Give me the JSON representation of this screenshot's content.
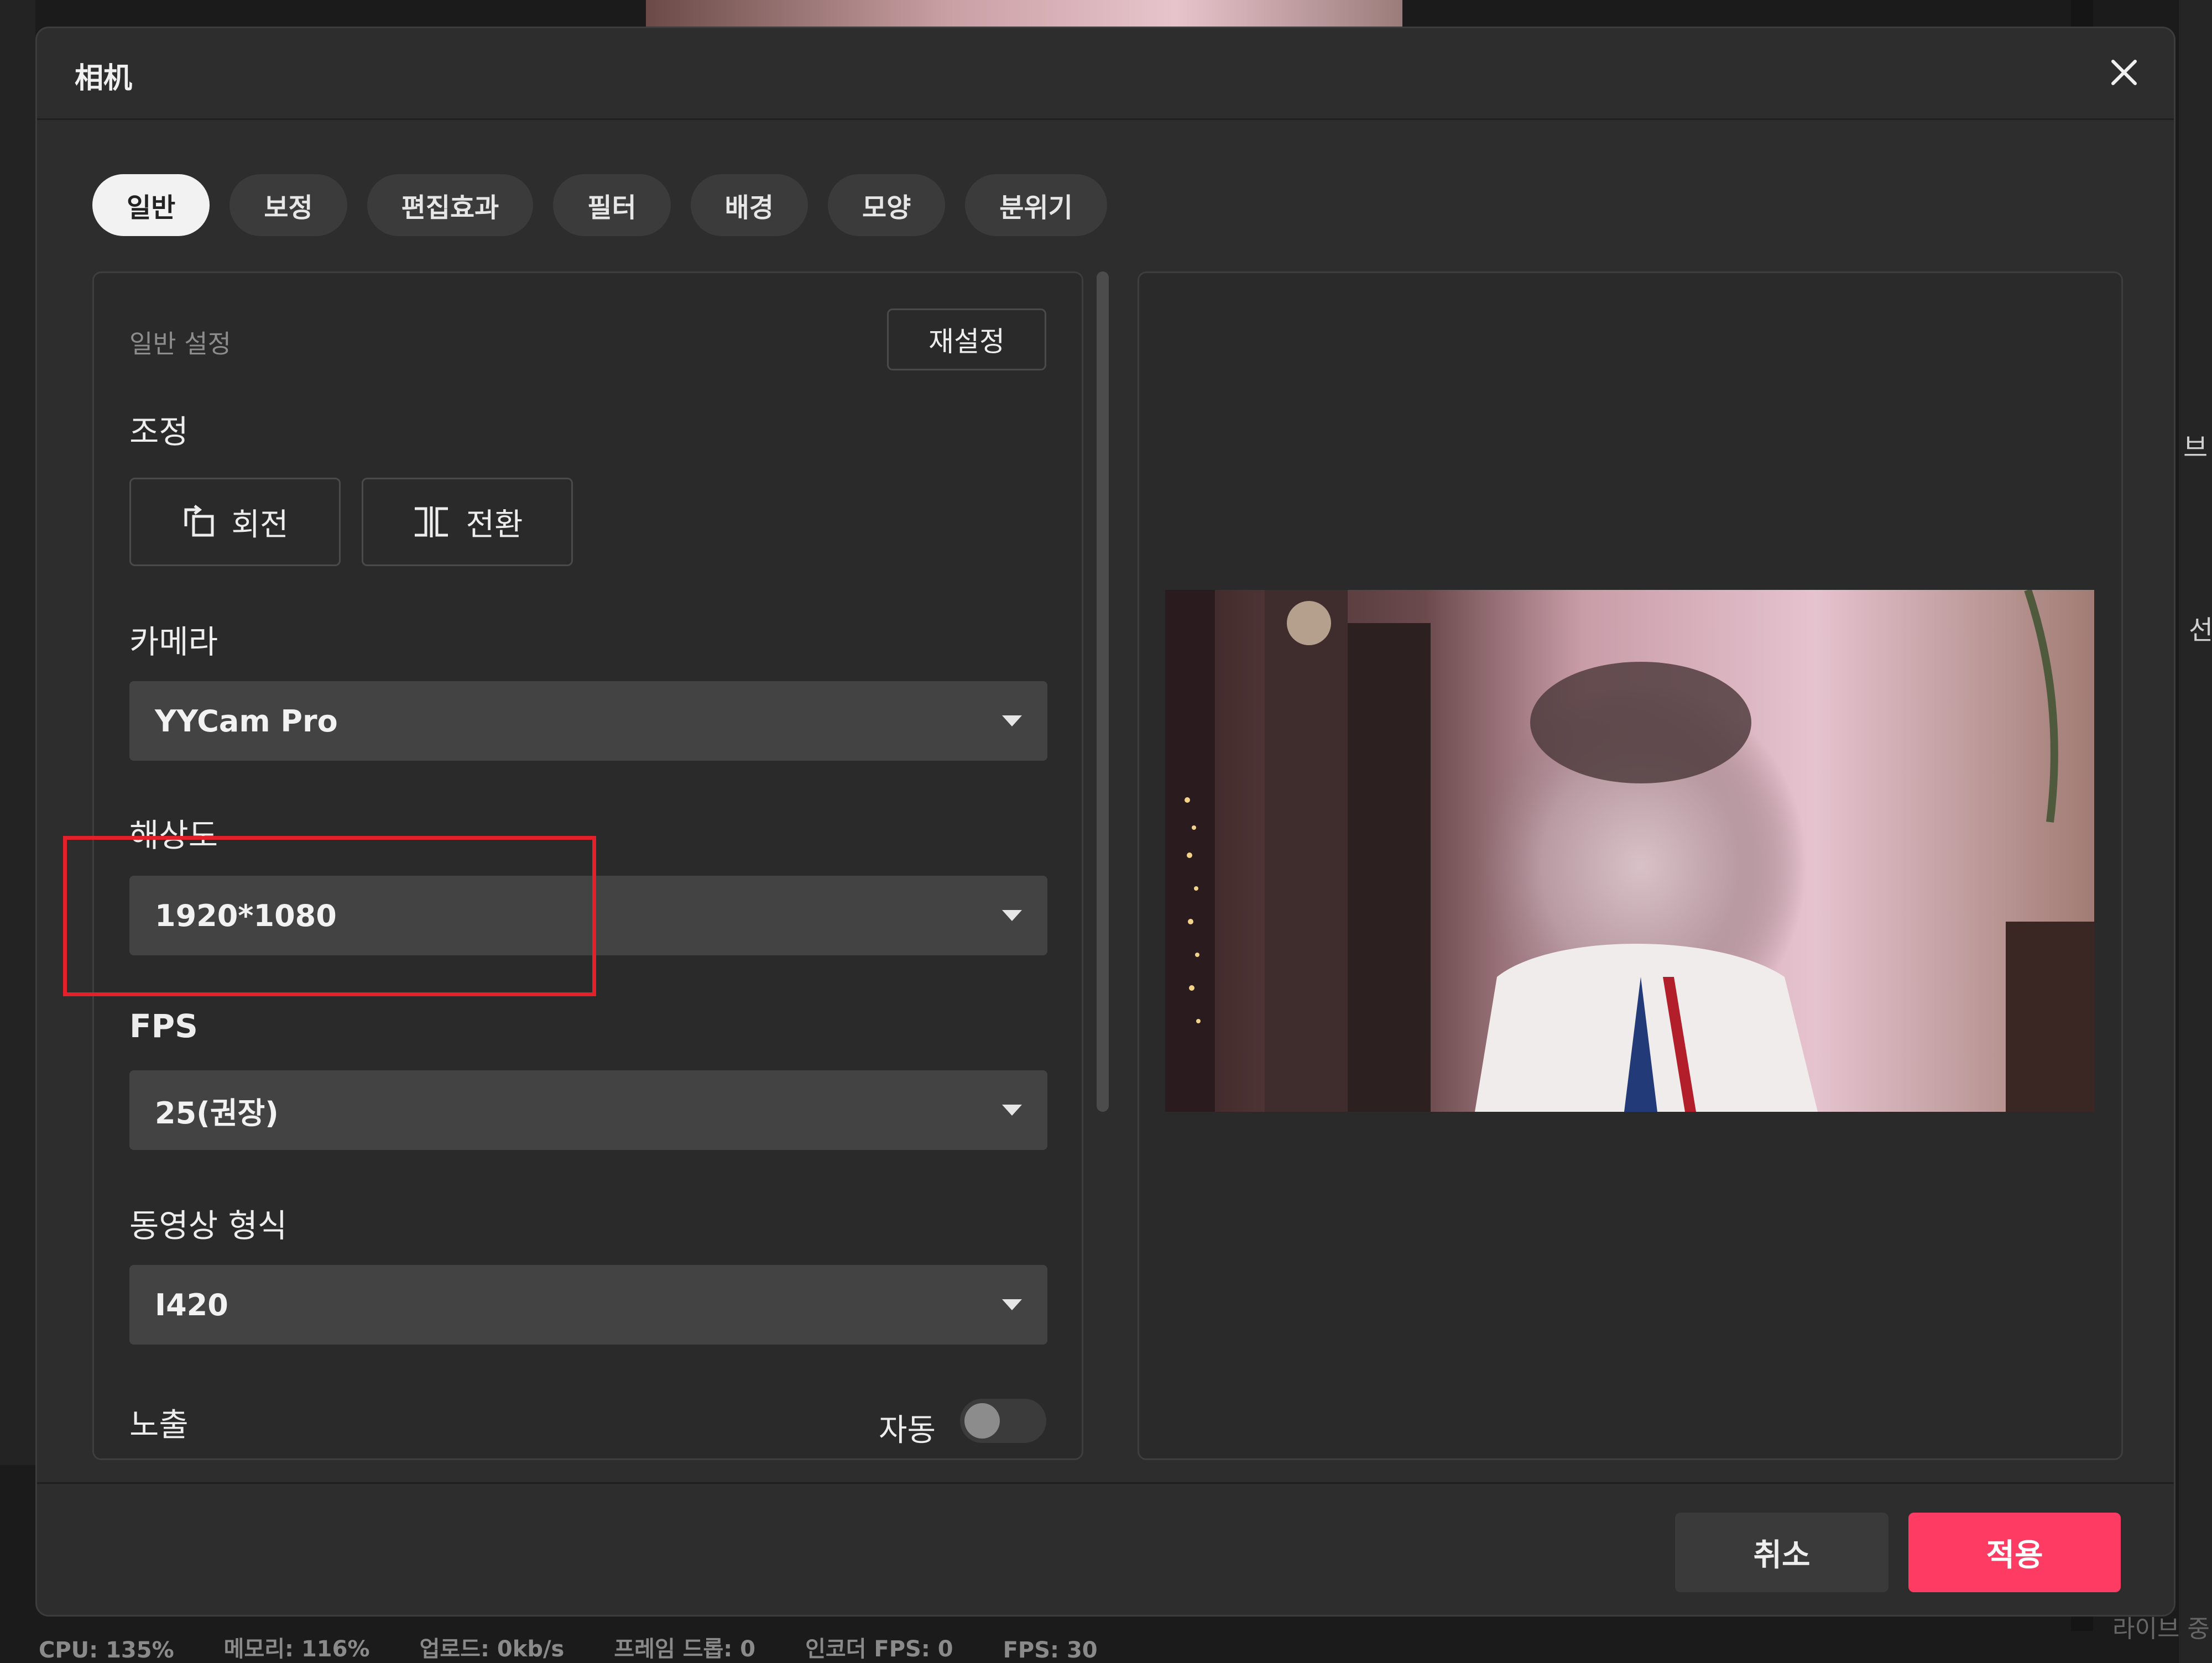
{
  "background": {
    "status_bar": [
      "CPU: 135%",
      "메모리: 116%",
      "업로드: 0kb/s",
      "프레임 드롭: 0",
      "인코더 FPS: 0",
      "FPS: 30"
    ],
    "right_panel_text": [
      "브",
      "선",
      "라이브 중"
    ]
  },
  "dialog": {
    "title": "相机",
    "tabs": [
      {
        "label": "일반",
        "active": true
      },
      {
        "label": "보정",
        "active": false
      },
      {
        "label": "편집효과",
        "active": false
      },
      {
        "label": "필터",
        "active": false
      },
      {
        "label": "배경",
        "active": false
      },
      {
        "label": "모양",
        "active": false
      },
      {
        "label": "분위기",
        "active": false
      }
    ],
    "settings": {
      "section_label": "일반 설정",
      "reset_label": "재설정",
      "adjust_label": "조정",
      "rotate_label": "회전",
      "flip_label": "전환",
      "camera_label": "카메라",
      "camera_value": "YYCam Pro",
      "resolution_label": "해상도",
      "resolution_value": "1920*1080",
      "fps_label": "FPS",
      "fps_value": "25(권장)",
      "format_label": "동영상 형식",
      "format_value": "I420",
      "exposure_label": "노출",
      "auto_label": "자동",
      "auto_enabled": false
    },
    "footer": {
      "cancel_label": "취소",
      "apply_label": "적용"
    }
  },
  "colors": {
    "accent": "#fe3c63",
    "highlight_box": "#e2212a",
    "dialog_bg": "#2d2d2d"
  }
}
